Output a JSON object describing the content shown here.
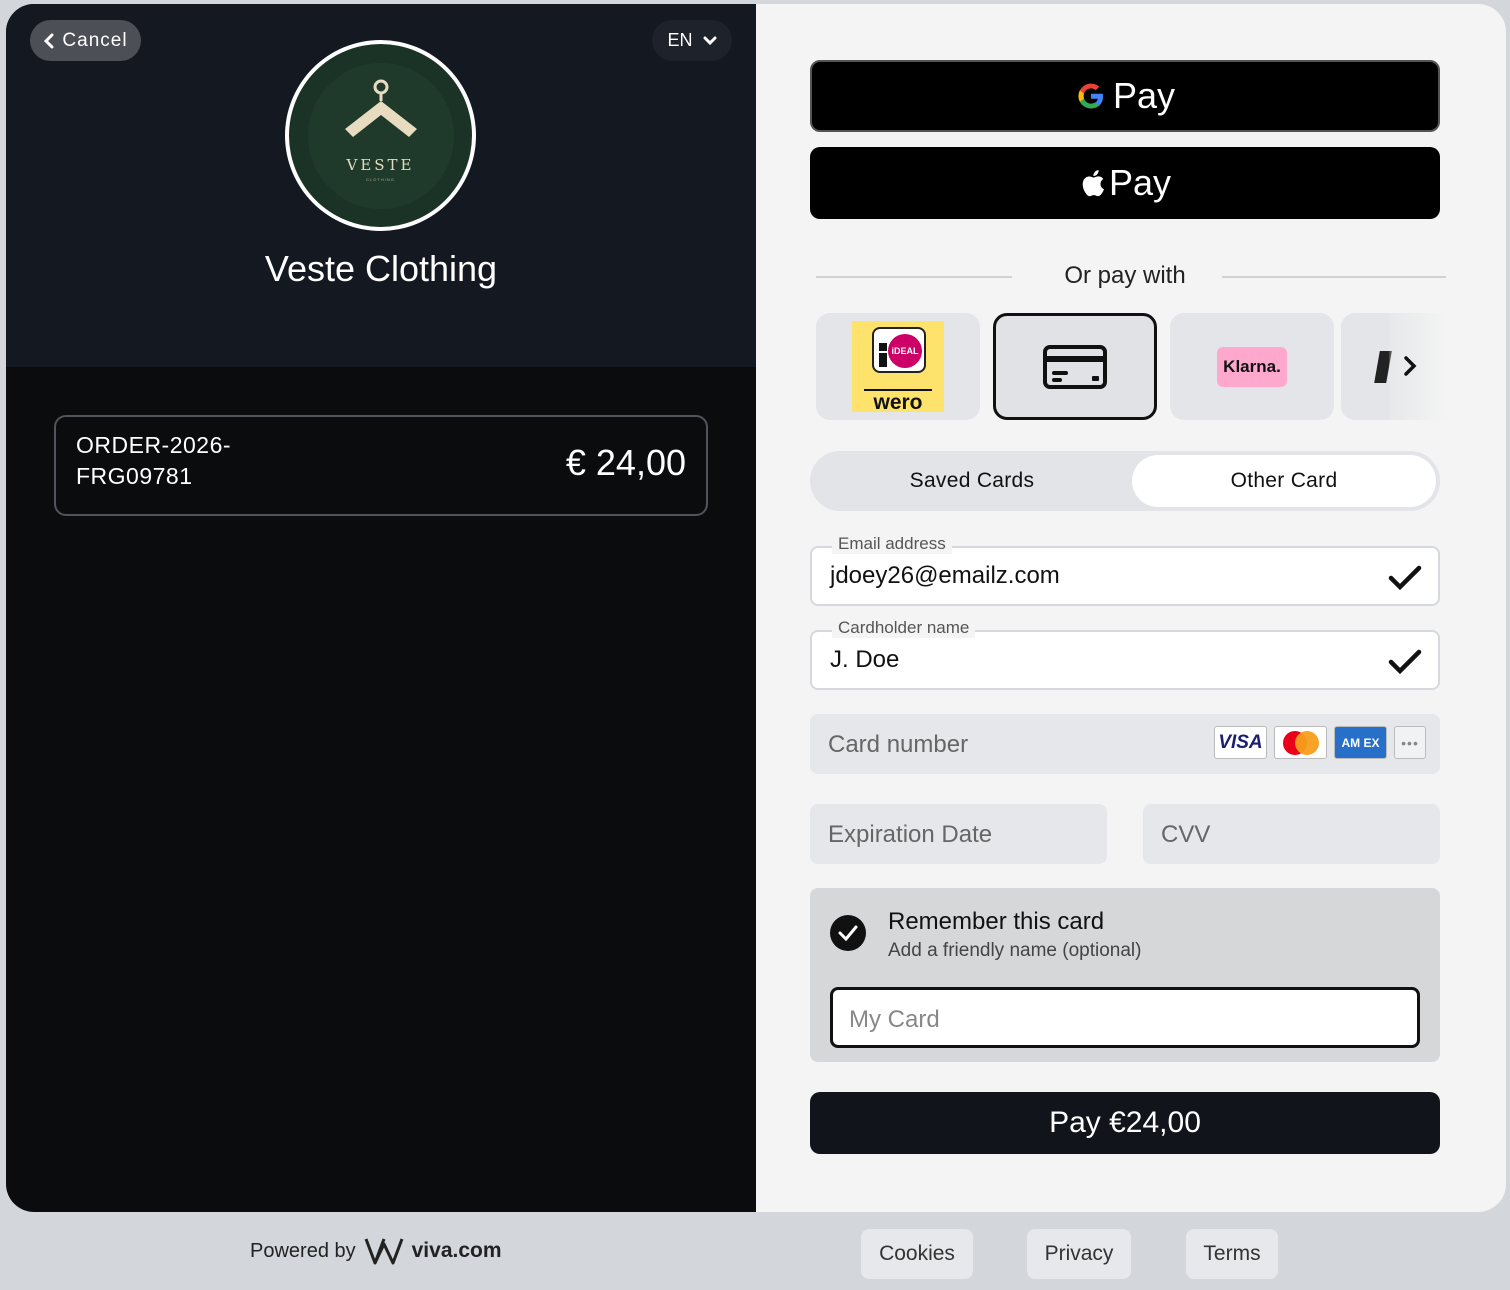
{
  "header": {
    "cancel_label": "Cancel",
    "language": "EN",
    "merchant_name": "Veste Clothing",
    "logo_text": "VESTE",
    "logo_subtext": "CLOTHING"
  },
  "order": {
    "id": "ORDER-2026-FRG09781",
    "amount": "€ 24,00"
  },
  "wallets": {
    "gpay_label": "Pay",
    "apay_label": "Pay"
  },
  "or_pay_with": "Or pay with",
  "methods": {
    "ideal_badge": "iDEAL",
    "wero": "wero",
    "klarna": "Klarna."
  },
  "tabs": {
    "saved": "Saved Cards",
    "other": "Other Card"
  },
  "form": {
    "email_label": "Email address",
    "email_value": "jdoey26@emailz.com",
    "name_label": "Cardholder name",
    "name_value": "J. Doe",
    "card_number_placeholder": "Card number",
    "expiry_placeholder": "Expiration Date",
    "cvv_placeholder": "CVV",
    "brands": {
      "visa": "VISA",
      "amex": "AM EX",
      "more": "•••"
    }
  },
  "remember": {
    "title": "Remember this card",
    "subtitle": "Add a friendly name (optional)",
    "placeholder": "My Card"
  },
  "pay_button": "Pay €24,00",
  "footer": {
    "powered_by": "Powered by",
    "brand": "viva.com",
    "links": [
      "Cookies",
      "Privacy",
      "Terms"
    ]
  },
  "colors": {
    "dark_panel": "#141820",
    "panel_bottom": "#0b0c0e",
    "pay_button": "#11141a",
    "klarna_pink": "#ffa8cd",
    "ideal_yellow": "#fde36b"
  }
}
